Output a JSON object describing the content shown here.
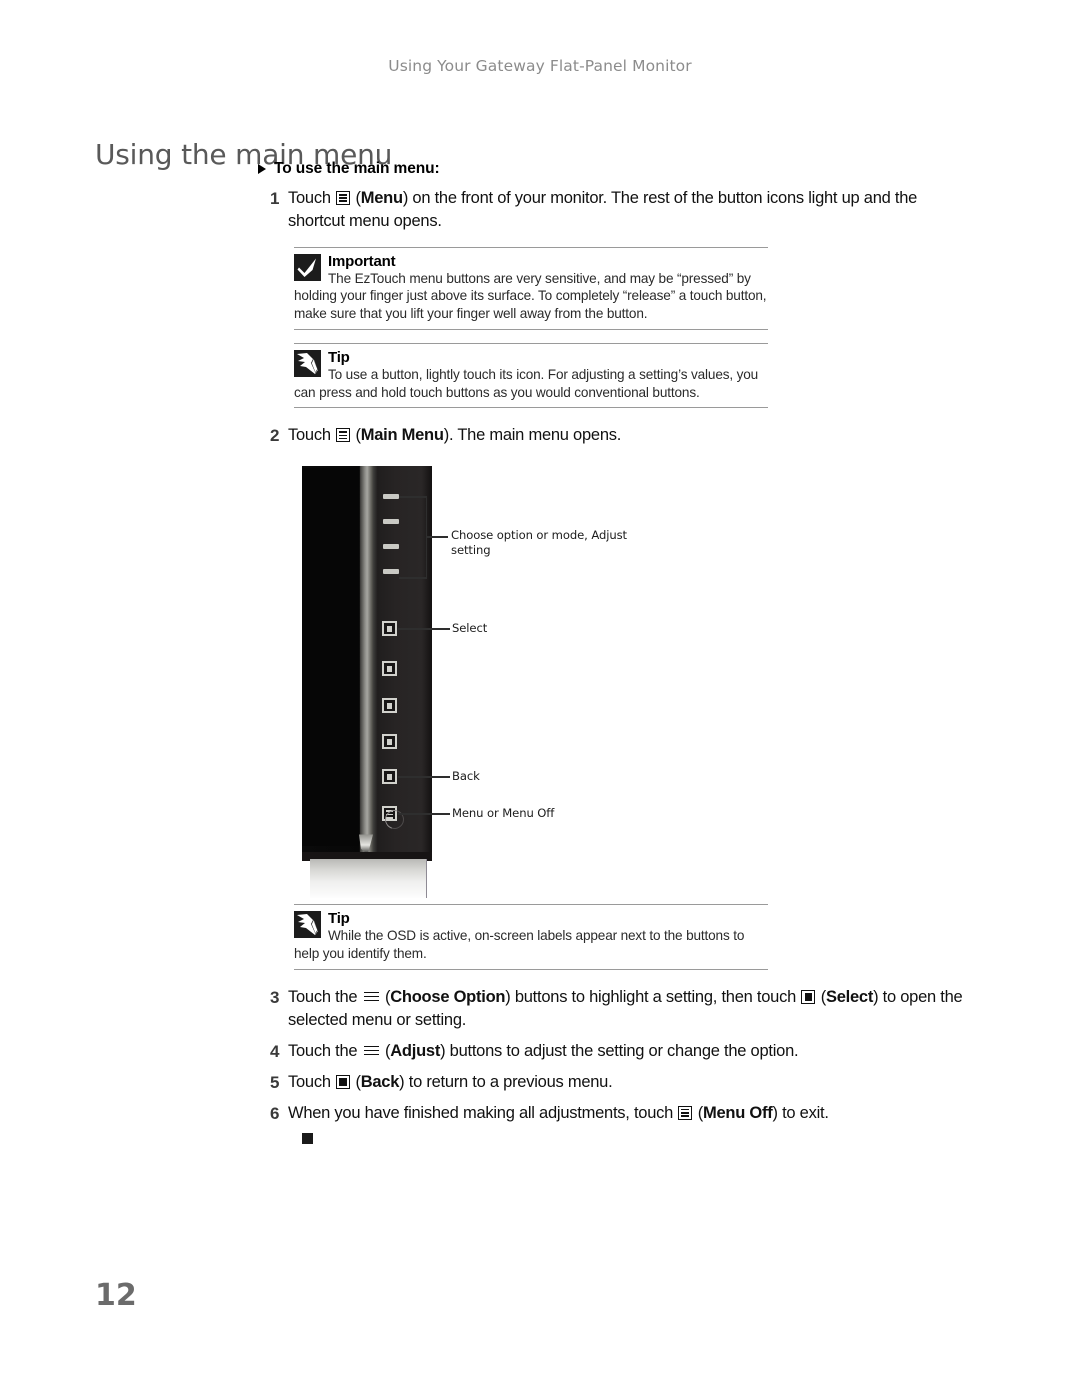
{
  "header": {
    "running_head": "Using Your Gateway Flat-Panel Monitor"
  },
  "page_title": "Using the main menu",
  "procedure": {
    "title": "To use the main menu:",
    "steps": [
      {
        "number": "1",
        "text_before_icon": "Touch ",
        "icon": "menu-box-icon",
        "text_after_icon": " (",
        "bold": "Menu",
        "text_tail": ") on the front of your monitor. The rest of the button icons light up and the shortcut menu opens."
      },
      {
        "number": "2",
        "text_before_icon": "Touch ",
        "icon": "menu-box-icon",
        "text_after_icon": " (",
        "bold": "Main Menu",
        "text_tail": "). The main menu opens."
      },
      {
        "number": "3",
        "text_before_icon": "Touch the ",
        "icon": "three-lines-icon",
        "text_after_icon": " (",
        "bold": "Choose Option",
        "text_mid": ") buttons to highlight a setting, then touch ",
        "icon2": "select-box-icon",
        "text_after_icon2": " (",
        "bold2": "Select",
        "text_tail": ") to open the selected menu or setting."
      },
      {
        "number": "4",
        "text_before_icon": "Touch the ",
        "icon": "three-lines-icon",
        "text_after_icon": " (",
        "bold": "Adjust",
        "text_tail": ") buttons to adjust the setting or change the option."
      },
      {
        "number": "5",
        "text_before_icon": "Touch ",
        "icon": "select-box-icon",
        "text_after_icon": " (",
        "bold": "Back",
        "text_tail": ") to return to a previous menu."
      },
      {
        "number": "6",
        "text_before_icon": "When you have finished making all adjustments, touch ",
        "icon": "menu-box-icon",
        "text_after_icon": " (",
        "bold": "Menu Off",
        "text_tail": ") to exit."
      }
    ]
  },
  "callouts": {
    "important": {
      "icon": "checkmark-icon",
      "label": "Important",
      "text": "The EzTouch menu buttons are very sensitive, and may be “pressed” by holding your finger just above its surface. To completely “release” a touch button, make sure that you lift your finger well away from the button."
    },
    "tip_1": {
      "icon": "pointing-hand-icon",
      "label": "Tip",
      "text": "To use a button, lightly touch its icon. For adjusting a setting’s values, you can press and hold touch buttons as you would conventional buttons."
    },
    "tip_2": {
      "icon": "pointing-hand-icon",
      "label": "Tip",
      "text": "While the OSD is active, on-screen labels appear next to the buttons to help you identify them."
    }
  },
  "figure": {
    "alt": "Gateway flat-panel monitor front bezel with EzTouch control buttons",
    "labels": [
      {
        "text": "Choose option or mode, Adjust\nsetting"
      },
      {
        "text": "Select"
      },
      {
        "text": "Back"
      },
      {
        "text": "Menu or Menu Off"
      }
    ]
  },
  "page_number": "12"
}
